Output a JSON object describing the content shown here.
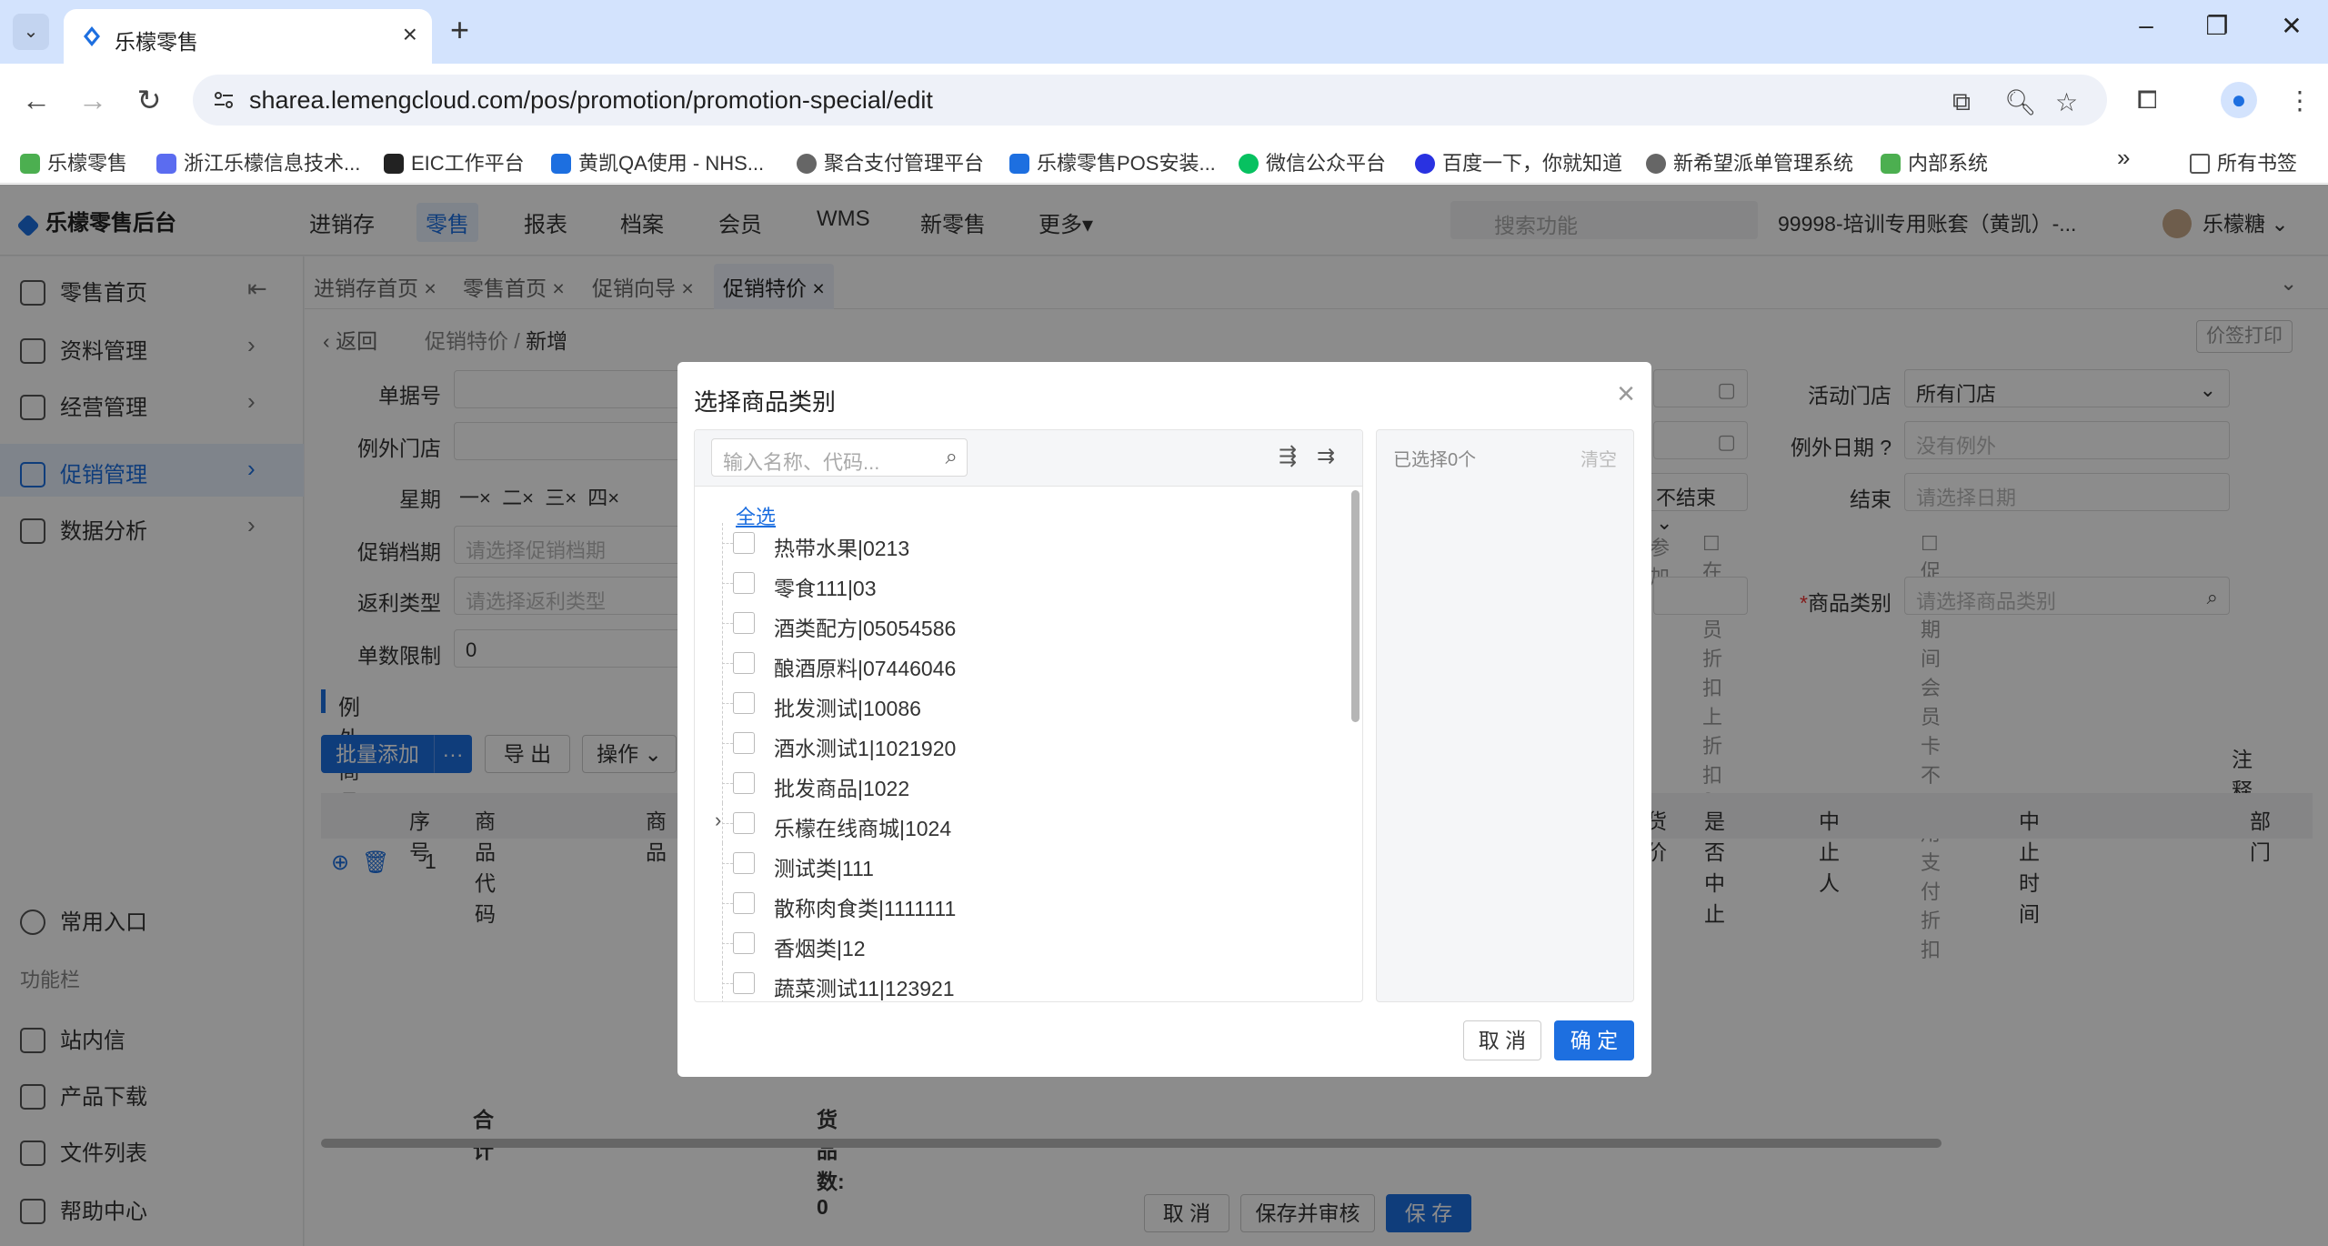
{
  "browser": {
    "tab_title": "乐檬零售",
    "url": "sharea.lemengcloud.com/pos/promotion/promotion-special/edit",
    "bookmarks": [
      "乐檬零售",
      "浙江乐檬信息技术...",
      "EIC工作平台",
      "黄凯QA使用 - NHS...",
      "聚合支付管理平台",
      "乐檬零售POS安装...",
      "微信公众平台",
      "百度一下，你就知道",
      "新希望派单管理系统",
      "内部系统"
    ],
    "all_bookmarks": "所有书签"
  },
  "app": {
    "logo": "乐檬零售后台",
    "top_nav": [
      "进销存",
      "零售",
      "报表",
      "档案",
      "会员",
      "WMS",
      "新零售",
      "更多"
    ],
    "search_placeholder": "搜索功能",
    "account": "99998-培训专用账套（黄凯）-...",
    "user": "乐檬糖"
  },
  "sidebar": {
    "items": [
      "零售首页",
      "资料管理",
      "经营管理",
      "促销管理",
      "数据分析"
    ],
    "common": "常用入口",
    "function_bar": "功能栏",
    "lower_items": [
      "站内信",
      "产品下载",
      "文件列表",
      "帮助中心"
    ]
  },
  "page_tabs": [
    "进销存首页",
    "零售首页",
    "促销向导",
    "促销特价"
  ],
  "breadcrumb": {
    "back": "返回",
    "parent": "促销特价",
    "current": "新增"
  },
  "print_button": "价签打印",
  "form": {
    "doc_no": "单据号",
    "exclude_store": "例外门店",
    "weekday": "星期",
    "weekdays": [
      "一",
      "二",
      "三",
      "四"
    ],
    "promo_file": "促销档期",
    "promo_file_ph": "请选择促销档期",
    "rebate_type": "返利类型",
    "rebate_type_ph": "请选择返利类型",
    "count_limit": "单数限制",
    "count_limit_val": "0",
    "active_store": "活动门店",
    "active_store_val": "所有门店",
    "exclude_date": "例外日期",
    "exclude_date_ph": "没有例外",
    "end": "结束",
    "end_ph": "请选择日期",
    "not_end": "不结束",
    "participate": "参加",
    "member_discount": "在会员折扣上折扣",
    "no_card_discount": "促销期间会员卡不启用支付折扣",
    "category": "商品类别",
    "category_ph": "请选择商品类别"
  },
  "exception_section": {
    "title": "例外商品",
    "batch_add": "批量添加",
    "export": "导 出",
    "operate": "操作",
    "note": "注释",
    "columns": [
      "序号",
      "商品代码",
      "商品",
      "货价",
      "是否中止",
      "中止人",
      "中止时间",
      "部门"
    ],
    "row_no": "1",
    "total": "合计",
    "goods_count": "货品数: 0"
  },
  "footer_buttons": [
    "取 消",
    "保存并审核",
    "保 存"
  ],
  "dialog": {
    "title": "选择商品类别",
    "search_placeholder": "输入名称、代码...",
    "select_all": "全选",
    "selected_count": "已选择0个",
    "clear": "清空",
    "categories": [
      "热带水果|0213",
      "零食111|03",
      "酒类配方|05054586",
      "酿酒原料|07446046",
      "批发测试|10086",
      "酒水测试1|1021920",
      "批发商品|1022",
      "乐檬在线商城|1024",
      "测试类|111",
      "散称肉食类|1111111",
      "香烟类|12",
      "蔬菜测试11|123921"
    ],
    "expandable_index": 7,
    "cancel": "取 消",
    "ok": "确 定"
  }
}
